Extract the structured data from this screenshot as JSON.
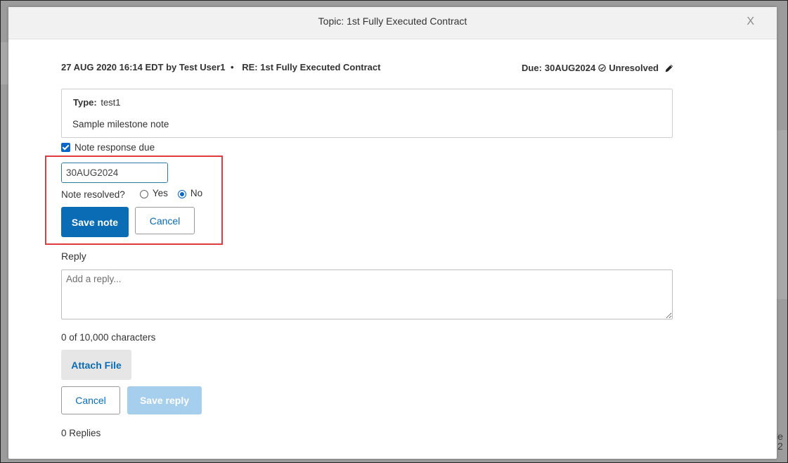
{
  "modal": {
    "title": "Topic: 1st Fully Executed Contract",
    "close_label": "X"
  },
  "note": {
    "timestamp": "27 AUG 2020 16:14 EDT",
    "by_label": "by",
    "author": "Test User1",
    "separator": "•",
    "subject": "RE: 1st Fully Executed Contract",
    "due_label": "Due:",
    "due_date": "30AUG2024",
    "status": "Unresolved",
    "type_label": "Type:",
    "type_value": "test1",
    "body": "Sample milestone note"
  },
  "edit_form": {
    "response_due_label": "Note response due",
    "response_due_checked": true,
    "date_value": "30AUG2024",
    "resolved_question": "Note resolved?",
    "yes_label": "Yes",
    "no_label": "No",
    "selected": "No",
    "save_label": "Save note",
    "cancel_label": "Cancel"
  },
  "reply": {
    "label": "Reply",
    "placeholder": "Add a reply...",
    "char_count": "0 of 10,000 characters",
    "attach_label": "Attach File",
    "cancel_label": "Cancel",
    "save_label": "Save reply",
    "replies_count": "0 Replies"
  },
  "background": {
    "corner_text_1": "le",
    "corner_text_2": "2"
  },
  "colors": {
    "primary": "#0a6cb5",
    "primary_disabled": "#a6cfee",
    "highlight": "#e03b3f",
    "checkbox": "#0a67c8"
  }
}
